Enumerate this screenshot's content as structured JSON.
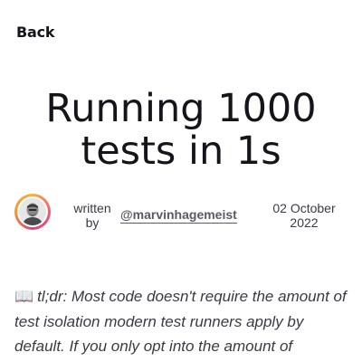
{
  "nav": {
    "back_label": "Back"
  },
  "article": {
    "title_line1": "Running 1000",
    "title_line2": "tests in 1s",
    "written_by": "written by",
    "author_handle": "@marvinhagemeist",
    "date": "02 October 2022",
    "excerpt_icon": "📖",
    "excerpt": "tl;dr: Most code doesn't require the amount of test isolation modern test runners apply by default. If you only opt into the amount of"
  },
  "icons": {
    "book": "book-icon",
    "avatar": "author-avatar"
  },
  "colors": {
    "text": "#14141b",
    "muted": "#3a3a44",
    "avatar_ring": "#ef5b7a"
  }
}
